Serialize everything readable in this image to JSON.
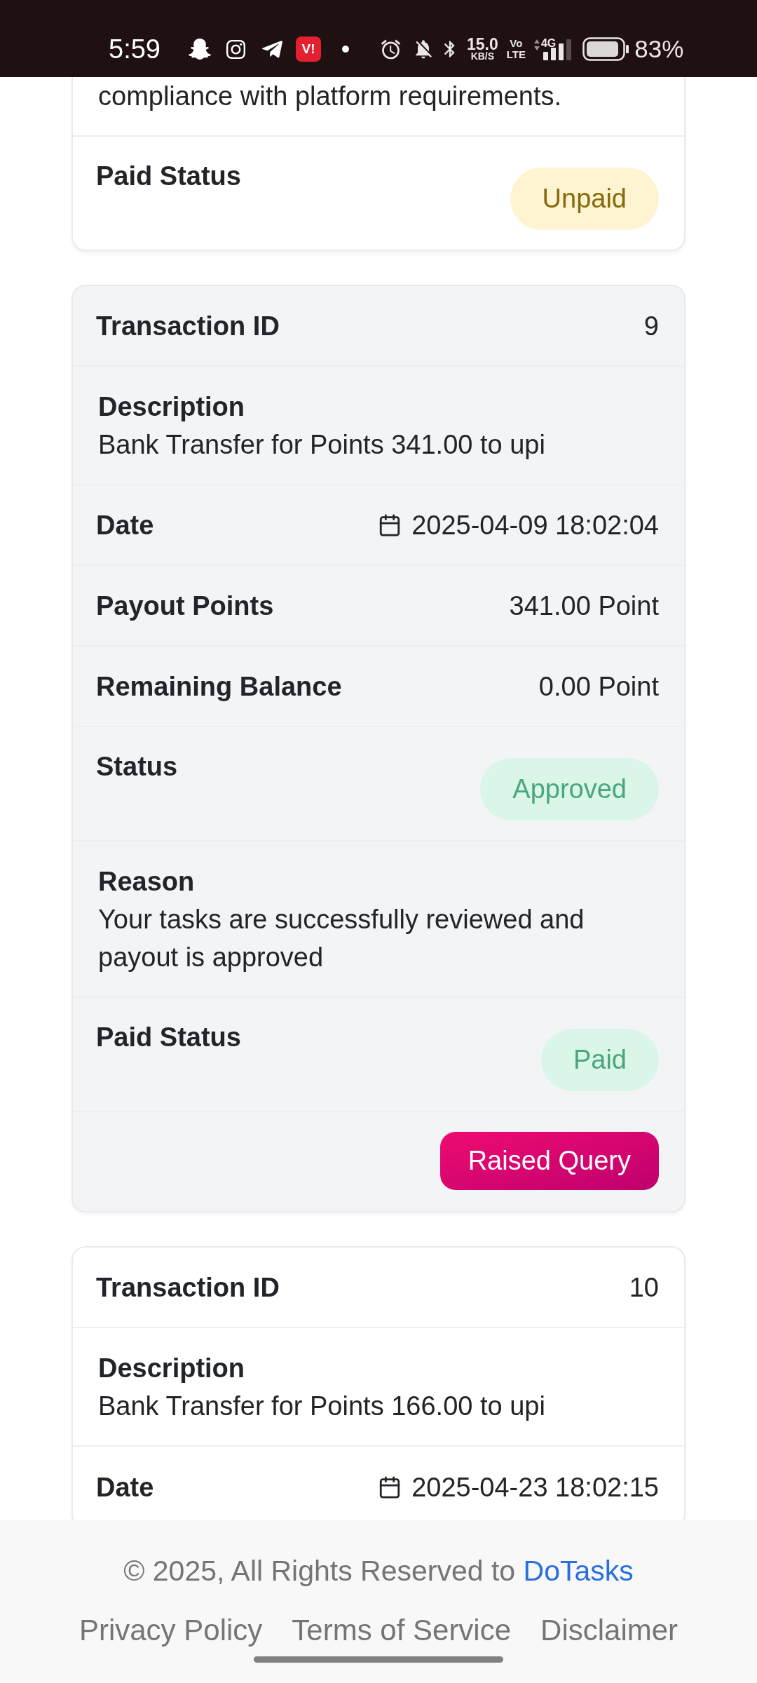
{
  "status_bar": {
    "time": "5:59",
    "carrier_logo": "V!",
    "network_speed": "15.0",
    "network_speed_unit": "KB/S",
    "volte_top": "Vo",
    "volte_bottom": "LTE",
    "network_type": "4G",
    "battery": "83%"
  },
  "transactions": [
    {
      "shaded": false,
      "rows": [
        {
          "kind": "tail",
          "value": "compliance with platform requirements."
        },
        {
          "kind": "badge",
          "label": "Paid Status",
          "value": "Unpaid",
          "color": "#866a0c"
        }
      ]
    },
    {
      "shaded": true,
      "rows": [
        {
          "kind": "pair",
          "label": "Transaction ID",
          "value": "9"
        },
        {
          "kind": "block",
          "label": "Description",
          "value": "Bank Transfer for Points 341.00 to upi"
        },
        {
          "kind": "date",
          "label": "Date",
          "value": "2025-04-09 18:02:04"
        },
        {
          "kind": "pair",
          "label": "Payout Points",
          "value": "341.00 Point"
        },
        {
          "kind": "pair",
          "label": "Remaining Balance",
          "value": "0.00 Point"
        },
        {
          "kind": "badge",
          "label": "Status",
          "value": "Approved",
          "color": "#4aa67b"
        },
        {
          "kind": "block",
          "label": "Reason",
          "value": "Your tasks are successfully reviewed and payout is approved"
        },
        {
          "kind": "badge",
          "label": "Paid Status",
          "value": "Paid",
          "color": "#4aa67b"
        },
        {
          "kind": "action",
          "label": "Raised Query"
        }
      ]
    },
    {
      "shaded": false,
      "rows": [
        {
          "kind": "pair",
          "label": "Transaction ID",
          "value": "10"
        },
        {
          "kind": "block",
          "label": "Description",
          "value": "Bank Transfer for Points 166.00 to upi"
        },
        {
          "kind": "date",
          "label": "Date",
          "value": "2025-04-23 18:02:15"
        }
      ]
    }
  ],
  "footer": {
    "copyright": "© 2025, All Rights Reserved to",
    "brand_link": "DoTasks",
    "links": [
      "Privacy Policy",
      "Terms of Service",
      "Disclaimer"
    ]
  }
}
